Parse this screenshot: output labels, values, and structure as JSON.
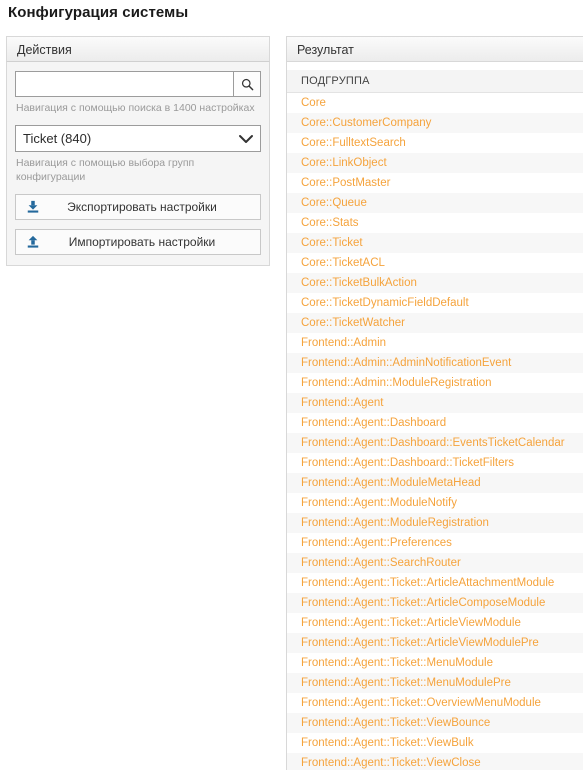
{
  "page": {
    "title": "Конфигурация системы"
  },
  "actions_panel": {
    "header": "Действия",
    "search": {
      "value": "",
      "placeholder": "",
      "icon": "search-icon",
      "hint": "Навигация с помощью поиска в 1400 настройках",
      "settings_count": "1400"
    },
    "group_select": {
      "selected": "Ticket (840)",
      "options": [
        "Ticket (840)"
      ],
      "icon": "chevron-down-icon",
      "hint": "Навигация с помощью выбора групп конфигурации"
    },
    "buttons": [
      {
        "label": "Экспортировать настройки",
        "icon": "download-icon"
      },
      {
        "label": "Импортировать настройки",
        "icon": "upload-icon"
      }
    ]
  },
  "result_panel": {
    "header": "Результат",
    "column_header": "ПОДГРУППА",
    "link_color": "#f5a33c",
    "rows": [
      "Core",
      "Core::CustomerCompany",
      "Core::FulltextSearch",
      "Core::LinkObject",
      "Core::PostMaster",
      "Core::Queue",
      "Core::Stats",
      "Core::Ticket",
      "Core::TicketACL",
      "Core::TicketBulkAction",
      "Core::TicketDynamicFieldDefault",
      "Core::TicketWatcher",
      "Frontend::Admin",
      "Frontend::Admin::AdminNotificationEvent",
      "Frontend::Admin::ModuleRegistration",
      "Frontend::Agent",
      "Frontend::Agent::Dashboard",
      "Frontend::Agent::Dashboard::EventsTicketCalendar",
      "Frontend::Agent::Dashboard::TicketFilters",
      "Frontend::Agent::ModuleMetaHead",
      "Frontend::Agent::ModuleNotify",
      "Frontend::Agent::ModuleRegistration",
      "Frontend::Agent::Preferences",
      "Frontend::Agent::SearchRouter",
      "Frontend::Agent::Ticket::ArticleAttachmentModule",
      "Frontend::Agent::Ticket::ArticleComposeModule",
      "Frontend::Agent::Ticket::ArticleViewModule",
      "Frontend::Agent::Ticket::ArticleViewModulePre",
      "Frontend::Agent::Ticket::MenuModule",
      "Frontend::Agent::Ticket::MenuModulePre",
      "Frontend::Agent::Ticket::OverviewMenuModule",
      "Frontend::Agent::Ticket::ViewBounce",
      "Frontend::Agent::Ticket::ViewBulk",
      "Frontend::Agent::Ticket::ViewClose"
    ]
  }
}
